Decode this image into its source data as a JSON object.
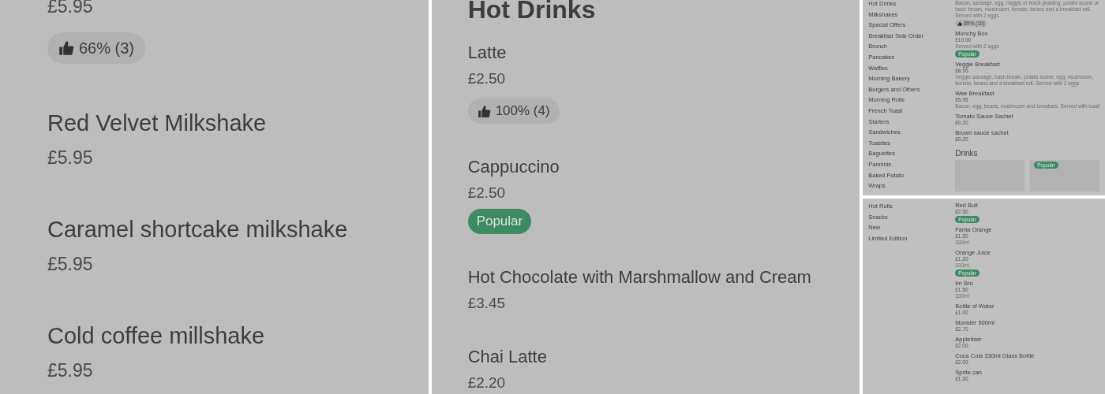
{
  "left_panel": {
    "items": [
      {
        "price": "£5.95",
        "rating": "66% (3)"
      },
      {
        "name": "Red Velvet Milkshake",
        "price": "£5.95"
      },
      {
        "name": "Caramel shortcake milkshake",
        "price": "£5.95"
      },
      {
        "name": "Cold coffee millshake",
        "price": "£5.95"
      }
    ]
  },
  "middle_panel": {
    "section_title": "Hot Drinks",
    "items": [
      {
        "name": "Latte",
        "price": "£2.50",
        "rating": "100% (4)"
      },
      {
        "name": "Cappuccino",
        "price": "£2.50",
        "badge": "Popular"
      },
      {
        "name": "Hot Chocolate with Marshmallow and Cream",
        "price": "£3.45"
      },
      {
        "name": "Chai Latte",
        "price": "£2.20"
      }
    ]
  },
  "right_top_panel": {
    "sidebar": {
      "items": [
        {
          "label": "Hot Drinks"
        },
        {
          "label": "Milkshakes"
        },
        {
          "label": "Special Offers"
        },
        {
          "label": "Breakfast Side Order"
        },
        {
          "label": "Brunch"
        },
        {
          "label": "Pancakes"
        },
        {
          "label": "Waffles"
        },
        {
          "label": "Morning Bakery"
        },
        {
          "label": "Burgers and Others"
        },
        {
          "label": "Morning Rolls"
        },
        {
          "label": "French Toast"
        },
        {
          "label": "Starters"
        },
        {
          "label": "Sandwiches"
        },
        {
          "label": "Toasties"
        },
        {
          "label": "Baguettes"
        },
        {
          "label": "Panninis"
        },
        {
          "label": "Baked Potato"
        },
        {
          "label": "Wraps"
        }
      ]
    },
    "items": [
      {
        "description": "Bacon, sausage, egg, haggis or black pudding, potato scone or hash brown, mushroom, tomato, beans and a breakfast roll. Served with 2 eggs.",
        "rating": "89% (10)"
      },
      {
        "name": "Munchy Box",
        "price": "£10.00",
        "description": "Served with 2 eggs",
        "badge": "Popular"
      },
      {
        "name": "Veggie Breakfast",
        "price": "£8.95",
        "description": "Veggie sausage, hash brown, potato scone, egg, mushroom, tomato, beans and a breakfast roll. Served with 2 eggs"
      },
      {
        "name": "Wee Breakfast",
        "price": "£5.95",
        "description": "Bacon, egg, beans, mushroom and tomatoes. Served with toast"
      },
      {
        "name": "Tomato Sauce Sachet",
        "price": "£0.20"
      },
      {
        "name": "Brown sauce sachet",
        "price": "£0.20"
      }
    ],
    "section_title": "Drinks",
    "cards": [
      {
        "kind": "picture"
      },
      {
        "kind": "picture",
        "badge": "Popular"
      }
    ]
  },
  "right_bottom_panel": {
    "sidebar": {
      "items": [
        {
          "label": "Hot Rolls"
        },
        {
          "label": "Snacks"
        },
        {
          "label": "New"
        },
        {
          "label": "Limited Edition"
        }
      ]
    },
    "items": [
      {
        "name": "Red Bull",
        "price": "£2.50",
        "badge": "Popular"
      },
      {
        "name": "Fanta Orange",
        "price": "£1.50",
        "description": "330ml"
      },
      {
        "name": "Orange Juice",
        "price": "£1.20",
        "description": "330ml",
        "badge": "Popular"
      },
      {
        "name": "Irn Bru",
        "price": "£1.50",
        "description": "330ml"
      },
      {
        "name": "Bottle of Water",
        "price": "£1.00"
      },
      {
        "name": "Monster 500ml",
        "price": "£2.70"
      },
      {
        "name": "Appletiser",
        "price": "£2.00"
      },
      {
        "name": "Coca Cola 330ml Glass Bottle",
        "price": "£2.00"
      },
      {
        "name": "Sprite can",
        "price": "£1.30"
      }
    ]
  }
}
